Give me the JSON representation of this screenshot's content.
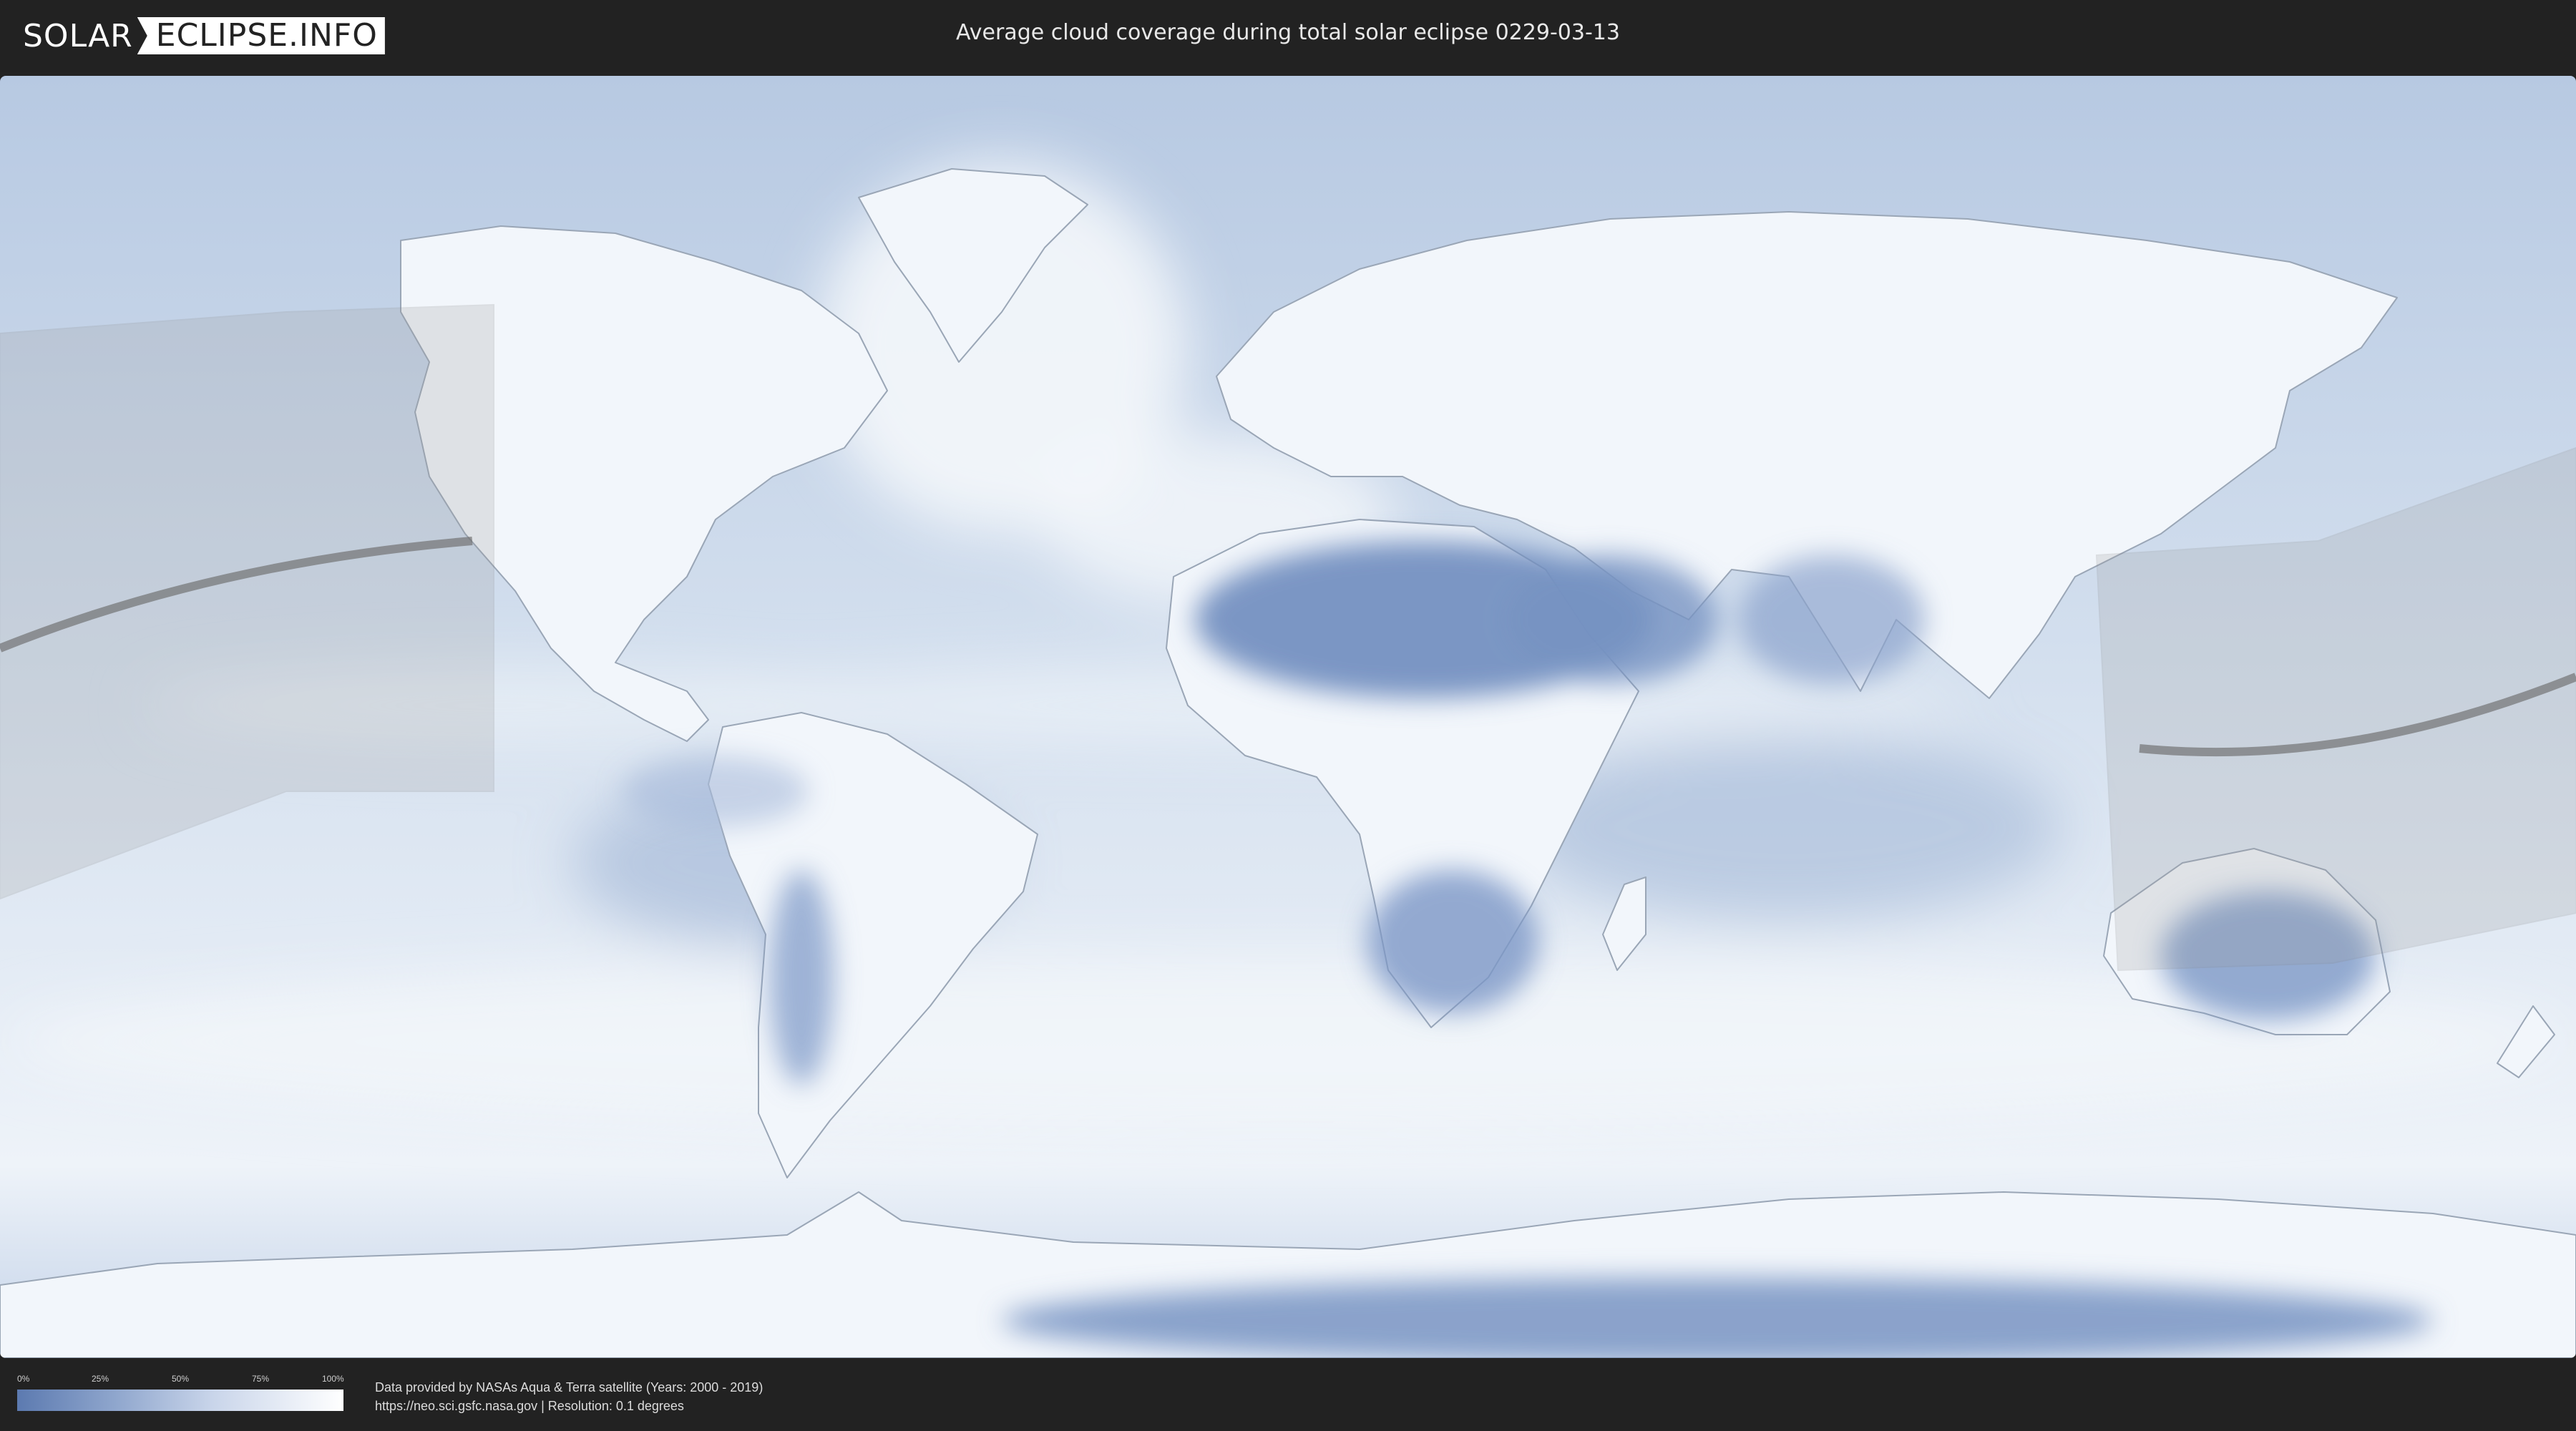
{
  "header": {
    "logo_left": "SOLAR",
    "logo_right": "ECLIPSE.INFO",
    "title": "Average cloud coverage during total solar eclipse 0229-03-13"
  },
  "map": {
    "land_color": "#f2f6fb",
    "ocean_color": "#c9d7ea",
    "low_cloud_color": "#5f7db3",
    "eclipse_shadow_color": "#9a9a9a",
    "central_line_color": "#6b6b6b"
  },
  "legend": {
    "ticks": [
      "0%",
      "25%",
      "50%",
      "75%",
      "100%"
    ],
    "gradient_from": "#5c7ab0",
    "gradient_to": "#ffffff"
  },
  "footer": {
    "line1": "Data provided by NASAs Aqua & Terra satellite (Years: 2000 - 2019)",
    "line2": "https://neo.sci.gsfc.nasa.gov | Resolution: 0.1 degrees"
  }
}
